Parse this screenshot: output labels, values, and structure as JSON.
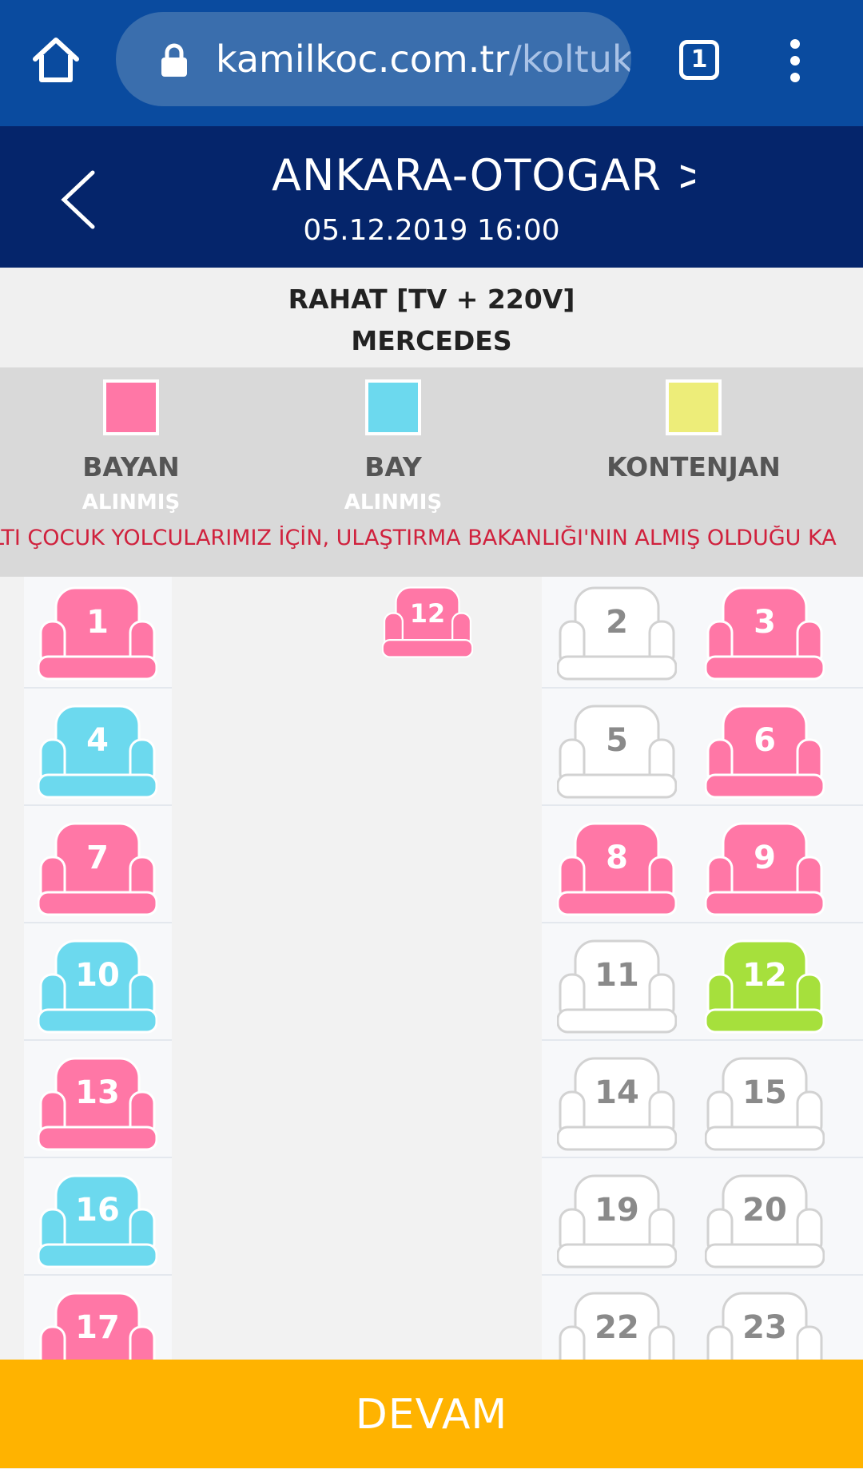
{
  "browser": {
    "url_host": "kamilkoc.com.tr",
    "url_path": "/koltuk",
    "tab_count": "1"
  },
  "trip": {
    "route": "ANKARA-OTOGAR",
    "datetime": "05.12.2019 16:00"
  },
  "bus": {
    "line1": "RAHAT [TV + 220V]",
    "line2": "MERCEDES"
  },
  "legend": {
    "items": [
      {
        "label": "BAYAN",
        "sub": "ALINMIŞ",
        "color": "#ff77a6"
      },
      {
        "label": "BAY",
        "sub": "ALINMIŞ",
        "color": "#6cd9ee"
      },
      {
        "label": "KONTENJAN",
        "sub": "",
        "color": "#eded79"
      }
    ],
    "notice": "LTI ÇOCUK YOLCULARIMIZ İÇİN, ULAŞTIRMA BAKANLIĞI'NIN ALMIŞ OLDUĞU KA"
  },
  "colors": {
    "female": "#ff77a6",
    "male": "#6cd9ee",
    "selected": "#a6e03c",
    "empty": "#ffffff"
  },
  "seats": [
    {
      "num": "1",
      "status": "female"
    },
    {
      "num": "12",
      "status": "female"
    },
    {
      "num": "2",
      "status": "empty"
    },
    {
      "num": "3",
      "status": "female"
    },
    {
      "num": "4",
      "status": "male"
    },
    {
      "num": "5",
      "status": "empty"
    },
    {
      "num": "6",
      "status": "female"
    },
    {
      "num": "7",
      "status": "female"
    },
    {
      "num": "8",
      "status": "female"
    },
    {
      "num": "9",
      "status": "female"
    },
    {
      "num": "10",
      "status": "male"
    },
    {
      "num": "11",
      "status": "empty"
    },
    {
      "num": "12",
      "status": "selected"
    },
    {
      "num": "13",
      "status": "female"
    },
    {
      "num": "14",
      "status": "empty"
    },
    {
      "num": "15",
      "status": "empty"
    },
    {
      "num": "16",
      "status": "male"
    },
    {
      "num": "19",
      "status": "empty"
    },
    {
      "num": "20",
      "status": "empty"
    },
    {
      "num": "17",
      "status": "female"
    },
    {
      "num": "22",
      "status": "empty"
    },
    {
      "num": "23",
      "status": "empty"
    }
  ],
  "actions": {
    "continue_label": "DEVAM"
  }
}
